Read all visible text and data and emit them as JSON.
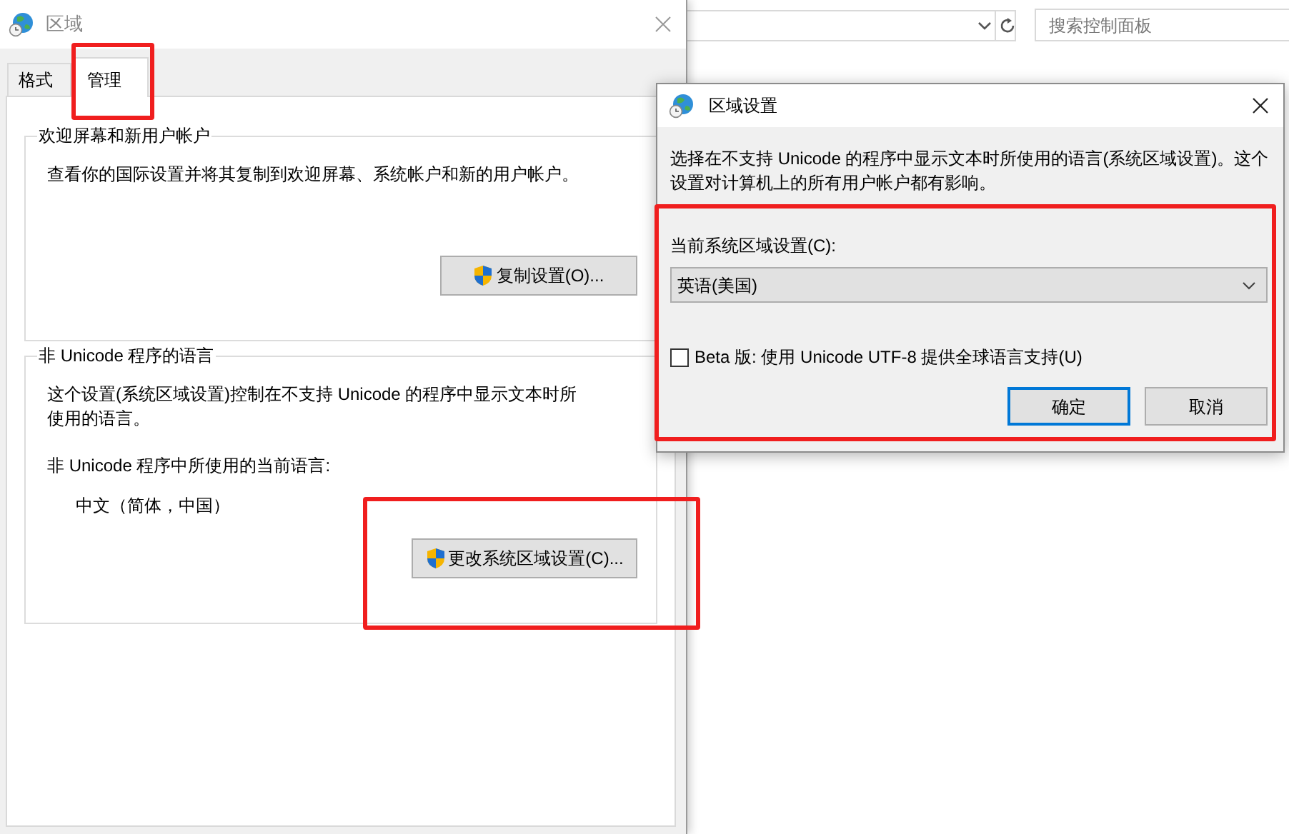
{
  "region_window": {
    "title": "区域",
    "tabs": [
      {
        "label": "格式",
        "selected": false
      },
      {
        "label": "管理",
        "selected": true
      }
    ],
    "groups": [
      {
        "title": "欢迎屏幕和新用户帐户",
        "paragraphs": [
          "查看你的国际设置并将其复制到欢迎屏幕、系统帐户和新的用户帐户。"
        ],
        "button": "复制设置(O)..."
      },
      {
        "title": "非 Unicode 程序的语言",
        "paragraphs": [
          "这个设置(系统区域设置)控制在不支持 Unicode 的程序中显示文本时所使用的语言。",
          "非 Unicode 程序中所使用的当前语言:"
        ],
        "value": "中文（简体，中国）",
        "button": "更改系统区域设置(C)..."
      }
    ]
  },
  "control_panel": {
    "search": {
      "placeholder": "搜索控制面板"
    }
  },
  "locale_dialog": {
    "title": "区域设置",
    "description": "选择在不支持 Unicode 的程序中显示文本时所使用的语言(系统区域设置)。这个设置对计算机上的所有用户帐户都有影响。",
    "locale_label": "当前系统区域设置(C):",
    "locale_value": "英语(美国)",
    "utf8_checkbox": {
      "label": "Beta 版: 使用 Unicode UTF-8 提供全球语言支持(U)",
      "checked": false
    },
    "buttons": [
      {
        "label": "确定",
        "default": true
      },
      {
        "label": "取消",
        "default": false
      }
    ]
  }
}
